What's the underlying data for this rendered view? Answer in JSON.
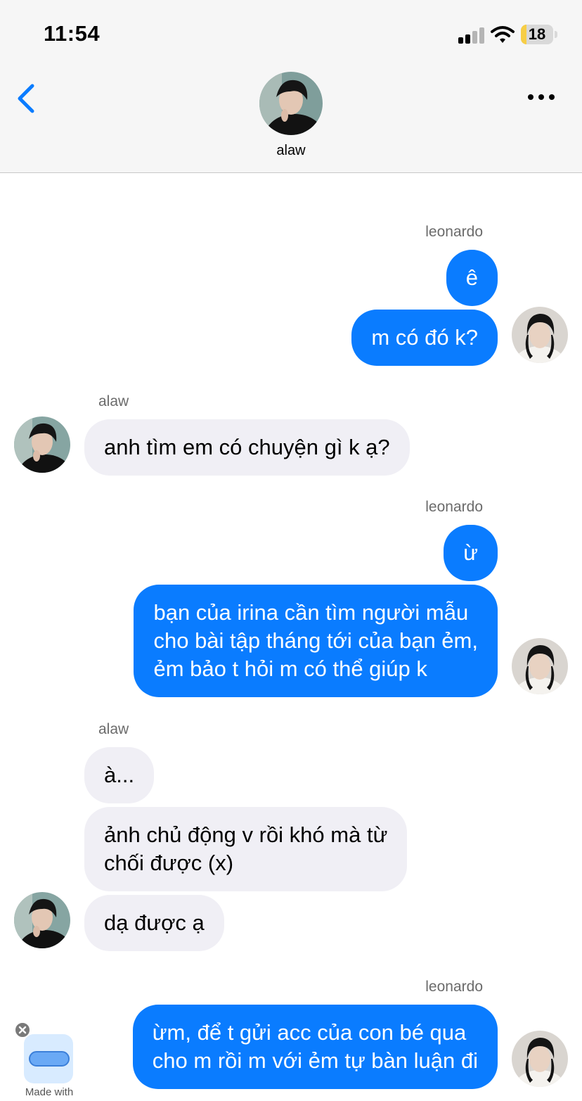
{
  "status": {
    "time": "11:54",
    "battery": "18",
    "battery_level": 0.18
  },
  "header": {
    "contact_name": "alaw"
  },
  "messages": [
    {
      "sender": "leonardo",
      "side": "right",
      "bubbles": [
        "ê",
        "m có đó k?"
      ]
    },
    {
      "sender": "alaw",
      "side": "left",
      "bubbles": [
        "anh tìm em có chuyện gì k ạ?"
      ]
    },
    {
      "sender": "leonardo",
      "side": "right",
      "bubbles": [
        "ừ",
        "bạn của irina cần tìm người mẫu\ncho bài tập tháng tới của bạn ẻm,\nẻm bảo t hỏi m có thể giúp k"
      ]
    },
    {
      "sender": "alaw",
      "side": "left",
      "bubbles": [
        "à...",
        "ảnh chủ động v rồi khó mà từ\nchối được (x)",
        "dạ được ạ"
      ]
    },
    {
      "sender": "leonardo",
      "side": "right",
      "bubbles": [
        "ừm, để t gửi acc của con bé qua\ncho m rồi m với ẻm tự bàn luận đi"
      ]
    }
  ],
  "overlay": {
    "label": "Made with"
  },
  "colors": {
    "outgoing": "#0a7cff",
    "incoming": "#f0eff5",
    "accent": "#0a7cff"
  },
  "icons": [
    "back-icon",
    "more-icon",
    "signal-icon",
    "wifi-icon",
    "battery-icon",
    "close-icon"
  ]
}
